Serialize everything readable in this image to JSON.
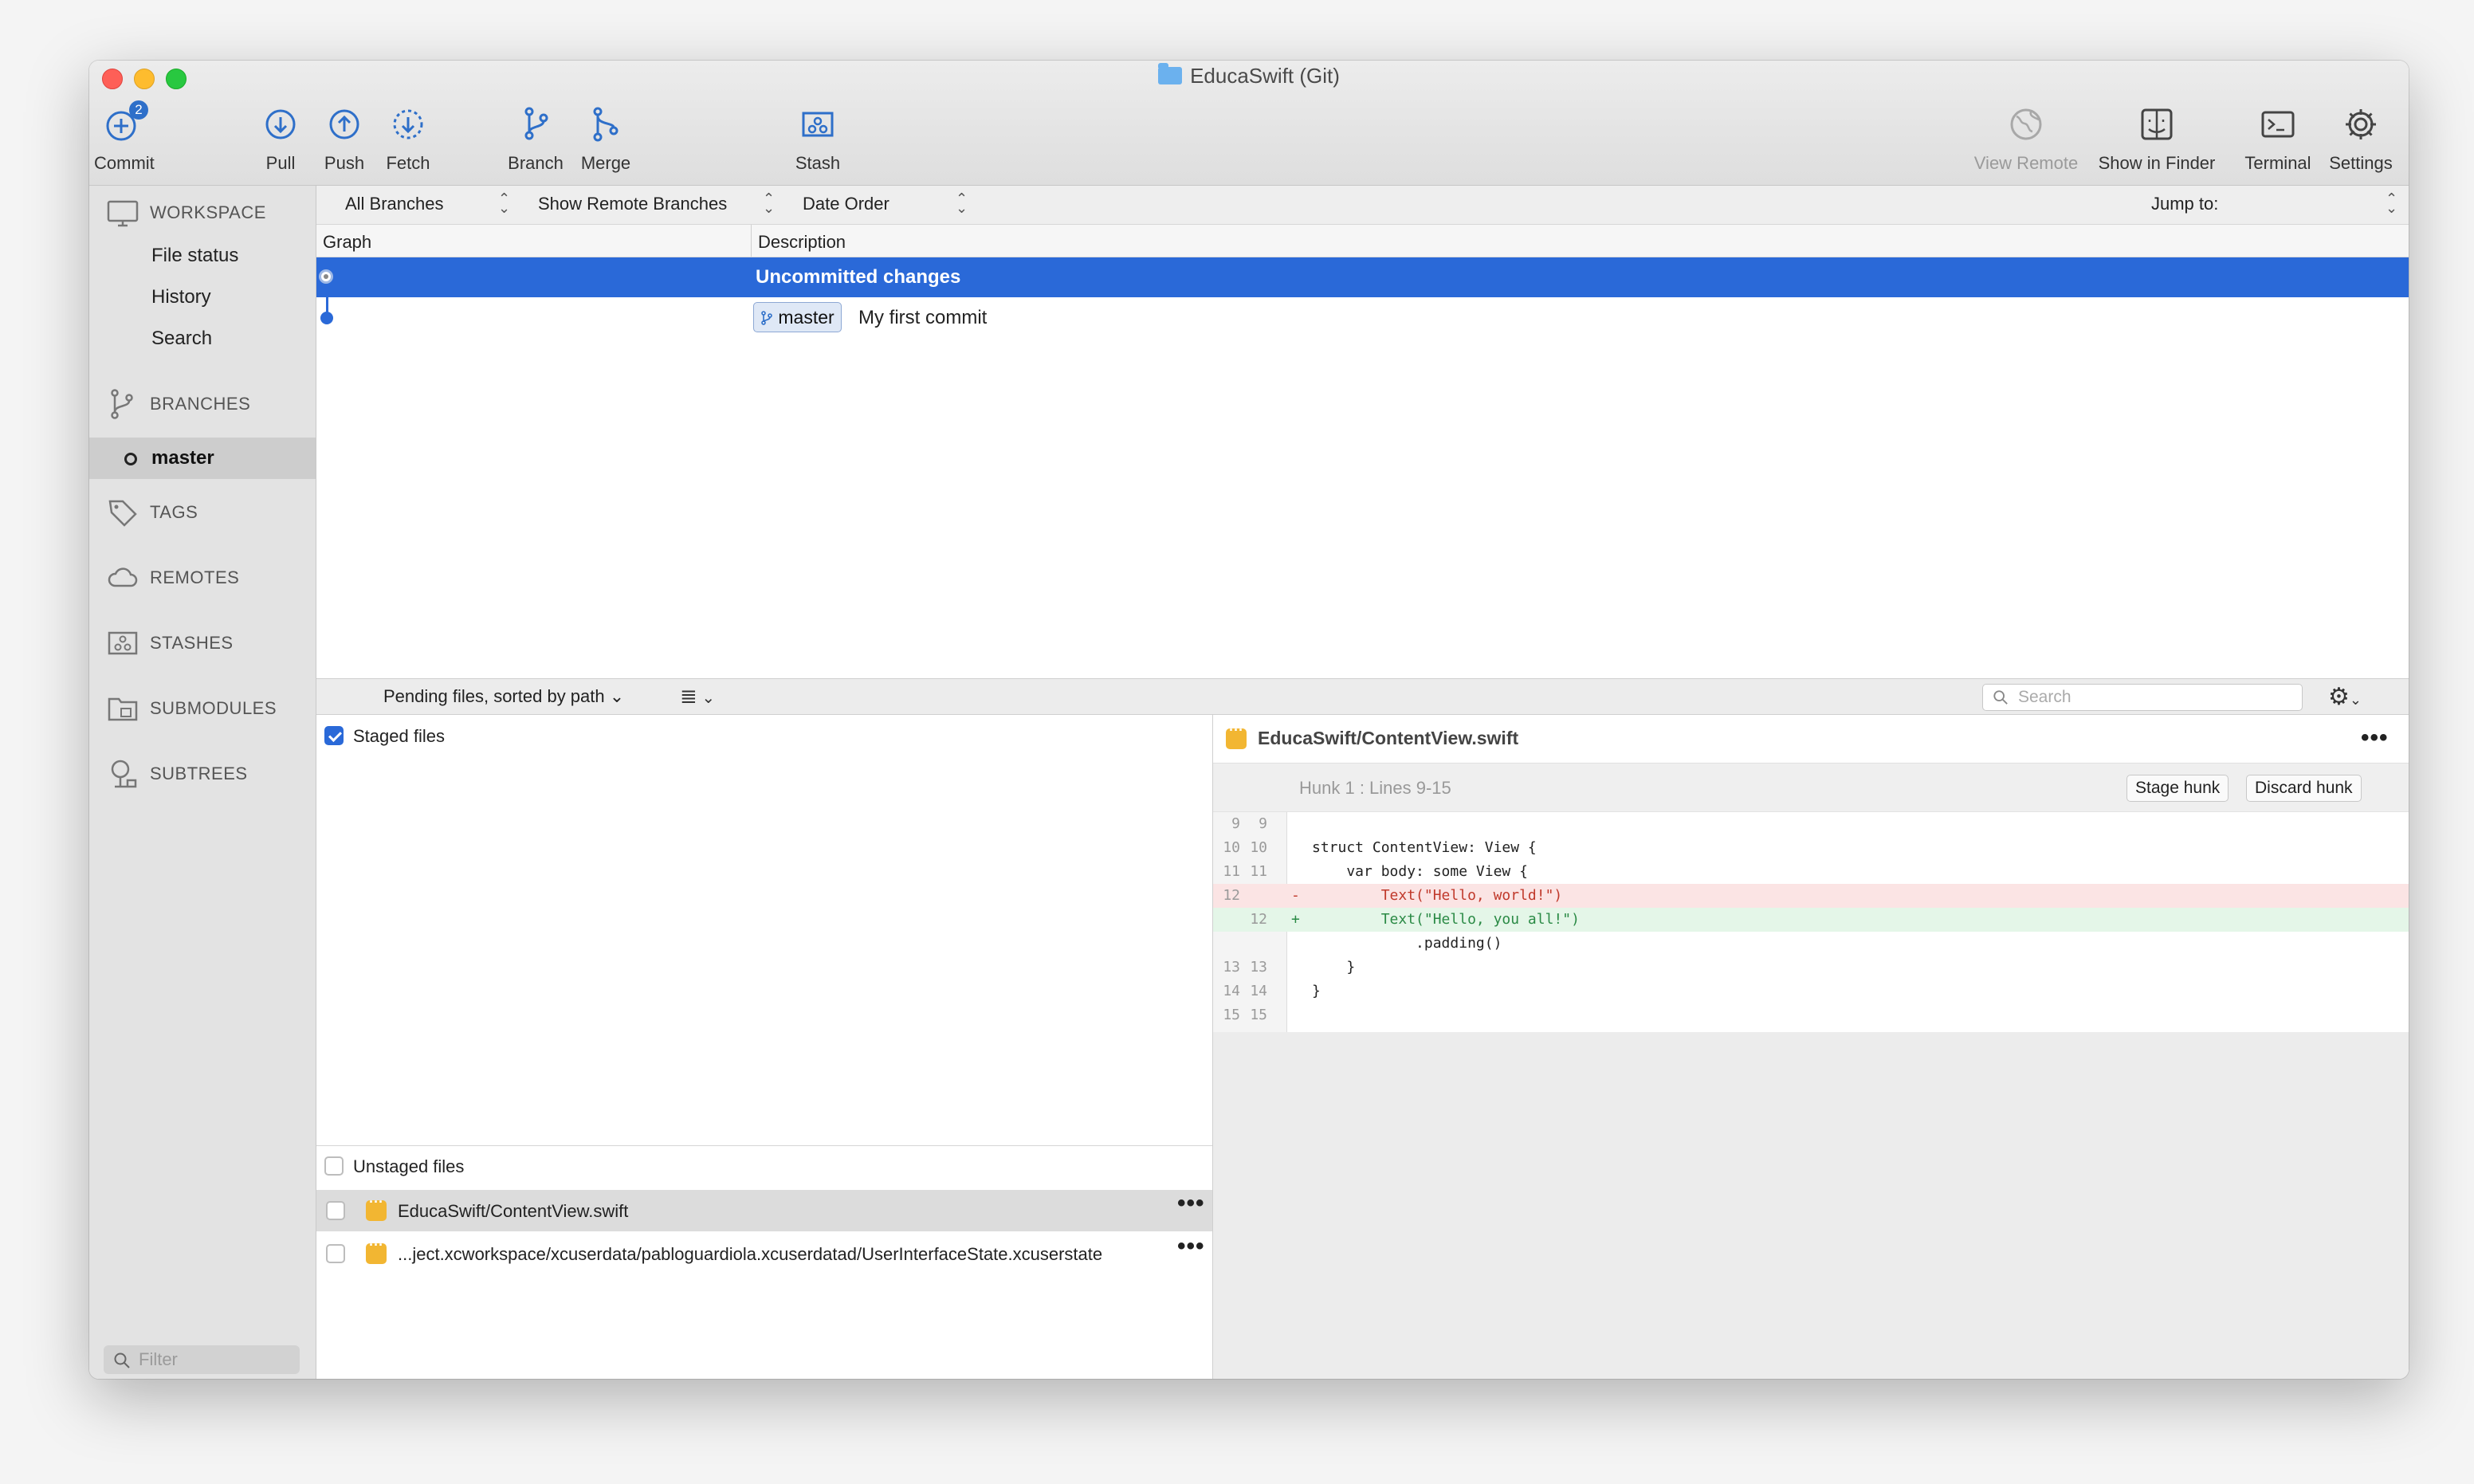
{
  "window": {
    "title": "EducaSwift (Git)"
  },
  "toolbar": {
    "commit": {
      "label": "Commit",
      "badge": "2"
    },
    "pull": "Pull",
    "push": "Push",
    "fetch": "Fetch",
    "branch": "Branch",
    "merge": "Merge",
    "stash": "Stash",
    "view_remote": "View Remote",
    "show_in_finder": "Show in Finder",
    "terminal": "Terminal",
    "settings": "Settings"
  },
  "sidebar": {
    "workspace": "WORKSPACE",
    "workspace_items": [
      "File status",
      "History",
      "Search"
    ],
    "branches": "BRANCHES",
    "current_branch": "master",
    "tags": "TAGS",
    "remotes": "REMOTES",
    "stashes": "STASHES",
    "submodules": "SUBMODULES",
    "subtrees": "SUBTREES",
    "filter_placeholder": "Filter"
  },
  "history": {
    "filters": {
      "branches": "All Branches",
      "remote": "Show Remote Branches",
      "order": "Date Order",
      "jump": "Jump to:"
    },
    "columns": {
      "graph": "Graph",
      "description": "Description"
    },
    "rows": [
      {
        "description": "Uncommitted changes"
      },
      {
        "branch_tag": "master",
        "description": "My first commit"
      }
    ]
  },
  "pending": {
    "sort_label": "Pending files, sorted by path",
    "search_placeholder": "Search",
    "staged_label": "Staged files",
    "unstaged_label": "Unstaged files",
    "files": [
      "EducaSwift/ContentView.swift",
      "...ject.xcworkspace/xcuserdata/pabloguardiola.xcuserdatad/UserInterfaceState.xcuserstate"
    ]
  },
  "diff": {
    "file": "EducaSwift/ContentView.swift",
    "hunk_label": "Hunk 1 : Lines 9-15",
    "stage_hunk": "Stage hunk",
    "discard_hunk": "Discard hunk",
    "lines": [
      {
        "old": "9",
        "new": "9",
        "mark": "",
        "text": ""
      },
      {
        "old": "10",
        "new": "10",
        "mark": "",
        "text": "struct ContentView: View {"
      },
      {
        "old": "11",
        "new": "11",
        "mark": "",
        "text": "    var body: some View {"
      },
      {
        "old": "12",
        "new": "",
        "mark": "-",
        "text": "        Text(\"Hello, world!\")"
      },
      {
        "old": "",
        "new": "12",
        "mark": "+",
        "text": "        Text(\"Hello, you all!\")"
      },
      {
        "old": "",
        "new": "",
        "mark": "",
        "text": "            .padding()"
      },
      {
        "old": "13",
        "new": "13",
        "mark": "",
        "text": "    }"
      },
      {
        "old": "14",
        "new": "14",
        "mark": "",
        "text": "}"
      },
      {
        "old": "15",
        "new": "15",
        "mark": "",
        "text": ""
      }
    ]
  },
  "colors": {
    "accent": "#2a69d8",
    "deleted_bg": "#fbe4e4",
    "added_bg": "#e4f6e8",
    "file_icon": "#f2b632"
  }
}
